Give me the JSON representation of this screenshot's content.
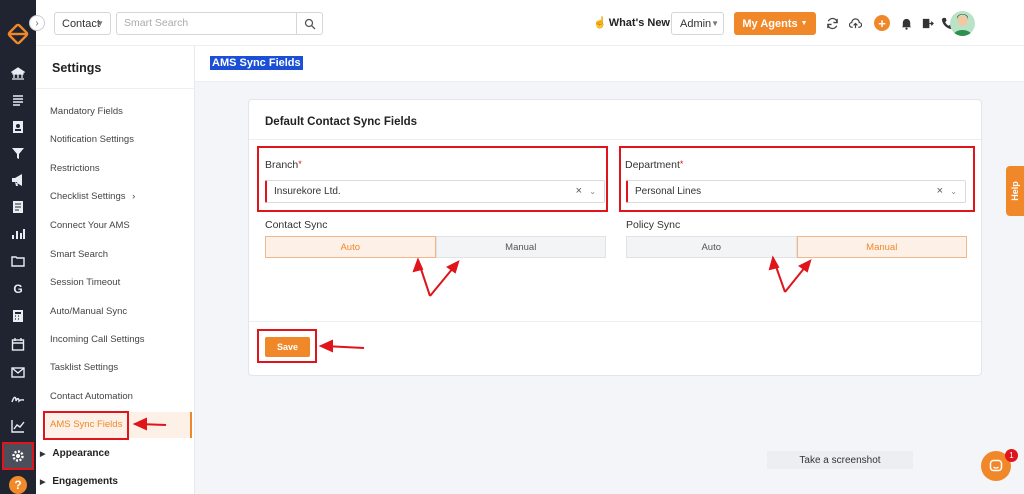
{
  "colors": {
    "accent": "#f0882a",
    "rail": "#1f2430",
    "annotation": "#e0141b",
    "highlight": "#1a4fd6"
  },
  "topbar": {
    "contact_dropdown": "Contact",
    "search_placeholder": "Smart Search",
    "whats_new": "What's New",
    "role_dropdown": "Admin",
    "agents_button": "My Agents",
    "icons": [
      "sync-icon",
      "cloud-upload-icon",
      "plus-icon",
      "bell-icon",
      "logout-icon",
      "phone-icon",
      "notes-icon",
      "avatar"
    ]
  },
  "rail": {
    "icons": [
      "bank-icon",
      "list-icon",
      "contact-card-icon",
      "filter-icon",
      "megaphone-icon",
      "document-icon",
      "bar-chart-icon",
      "folder-icon",
      "google-icon",
      "calculator-icon",
      "calendar-icon",
      "mail-icon",
      "signature-icon",
      "line-chart-icon",
      "settings-icon",
      "help-icon"
    ]
  },
  "sidebar": {
    "title": "Settings",
    "items": [
      {
        "label": "Mandatory Fields"
      },
      {
        "label": "Notification Settings"
      },
      {
        "label": "Restrictions"
      },
      {
        "label": "Checklist Settings"
      },
      {
        "label": "Connect Your AMS"
      },
      {
        "label": "Smart Search"
      },
      {
        "label": "Session Timeout"
      },
      {
        "label": "Auto/Manual Sync"
      },
      {
        "label": "Incoming Call Settings"
      },
      {
        "label": "Tasklist Settings"
      },
      {
        "label": "Contact Automation"
      },
      {
        "label": "AMS Sync Fields"
      }
    ],
    "groups": [
      {
        "label": "Appearance"
      },
      {
        "label": "Engagements"
      }
    ]
  },
  "main": {
    "page_title": "AMS Sync Fields",
    "card_title": "Default Contact Sync Fields",
    "branch": {
      "label": "Branch",
      "required_mark": "*",
      "value": "Insurekore Ltd."
    },
    "department": {
      "label": "Department",
      "required_mark": "*",
      "value": "Personal Lines"
    },
    "contact_sync": {
      "label": "Contact Sync",
      "options": [
        "Auto",
        "Manual"
      ],
      "selected": "Auto"
    },
    "policy_sync": {
      "label": "Policy Sync",
      "options": [
        "Auto",
        "Manual"
      ],
      "selected": "Manual"
    },
    "save_label": "Save"
  },
  "widgets": {
    "help_tab": "Help",
    "screenshot_label": "Take a screenshot",
    "chat_badge": "1"
  }
}
